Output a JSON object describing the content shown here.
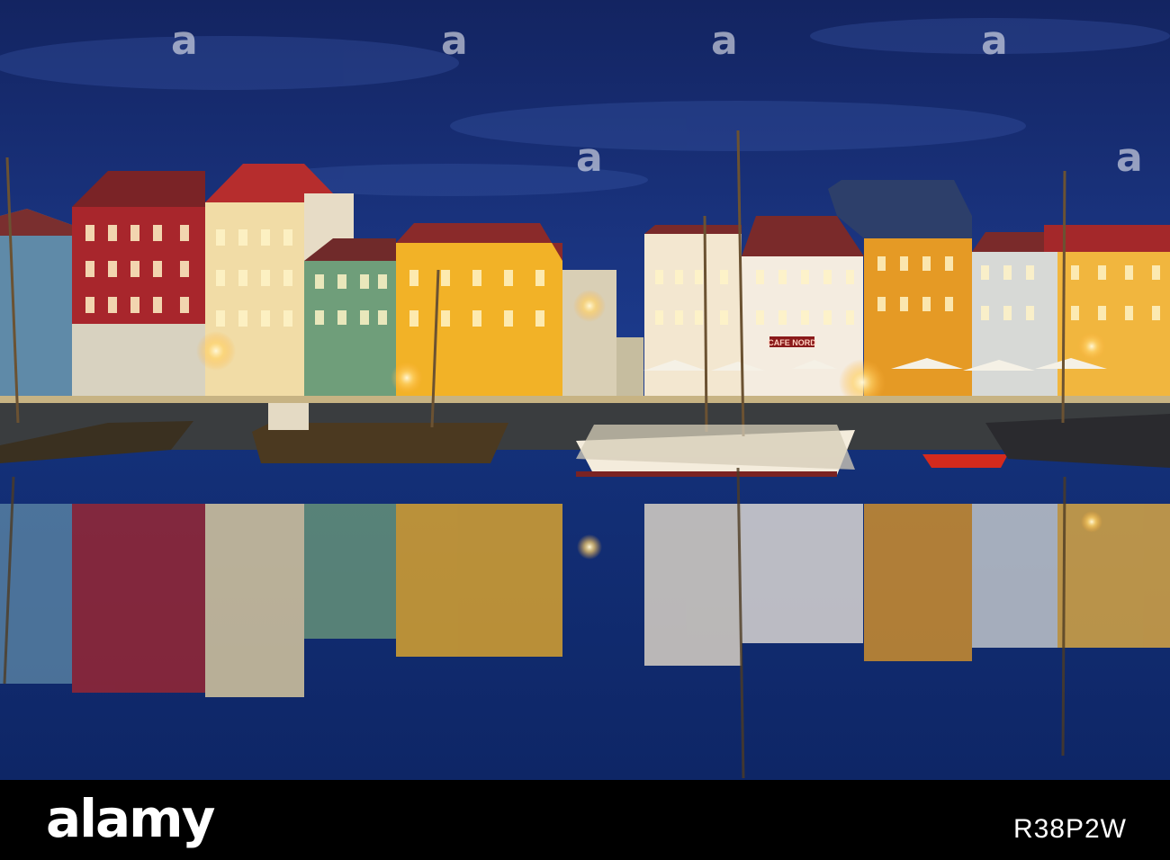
{
  "photo": {
    "sky_color": "#1a2d6b",
    "water_color": "#0f2a6e",
    "buildings": [
      {
        "name": "blue-house",
        "color": "#5f8aa8"
      },
      {
        "name": "red-house",
        "color": "#a8262c"
      },
      {
        "name": "cream-house",
        "color": "#f1dca6"
      },
      {
        "name": "green-house",
        "color": "#6f9e7a"
      },
      {
        "name": "yellow-house",
        "color": "#f2b227"
      },
      {
        "name": "white-house",
        "color": "#f3e7d0"
      },
      {
        "name": "white-house-2",
        "color": "#f4ece0"
      },
      {
        "name": "orange-house",
        "color": "#e59a25"
      },
      {
        "name": "grey-house",
        "color": "#d7d9d6"
      },
      {
        "name": "yellow-house-2",
        "color": "#f1b63e"
      }
    ],
    "sign_text": "CAFE NORD"
  },
  "watermark": {
    "text": "a"
  },
  "footer": {
    "logo_text": "alamy",
    "image_id": "R38P2W"
  }
}
